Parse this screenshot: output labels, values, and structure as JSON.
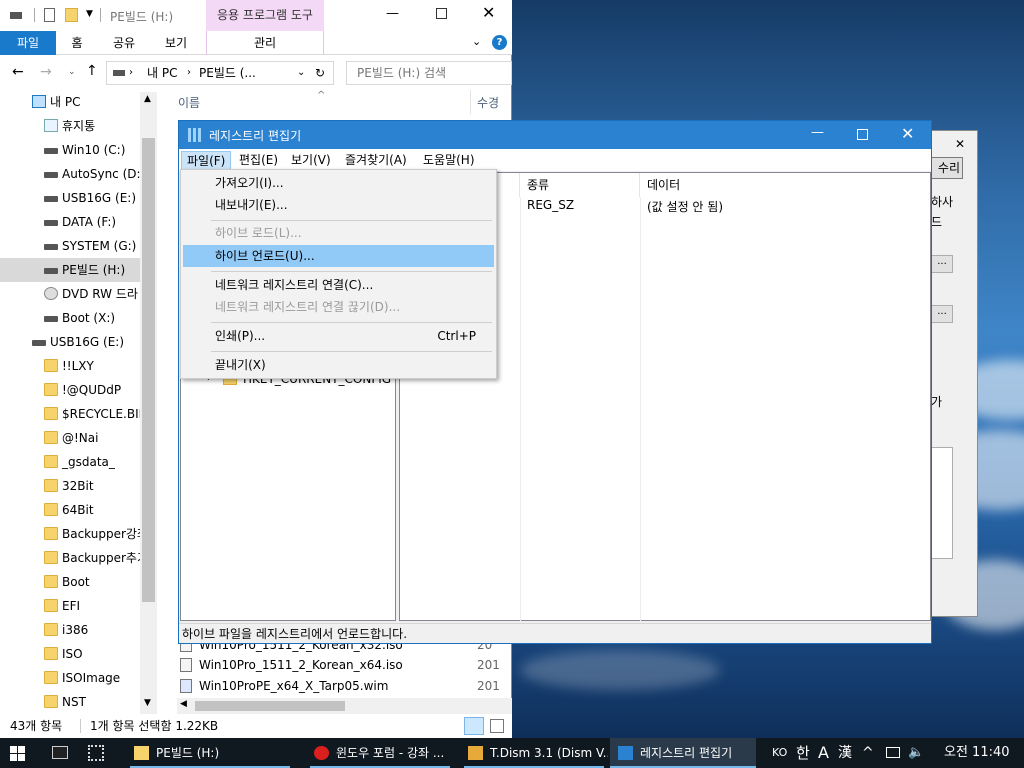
{
  "explorer": {
    "title": "PE빌드 (H:)",
    "contextual_tab": "응용 프로그램 도구",
    "tabs": {
      "file": "파일",
      "home": "홈",
      "share": "공유",
      "view": "보기",
      "manage": "관리"
    },
    "address": {
      "root": "내 PC",
      "current": "PE빌드 (..."
    },
    "search_placeholder": "PE빌드 (H:) 검색",
    "nav": [
      {
        "label": "내 PC",
        "icon": "pc-icon"
      },
      {
        "label": "휴지통",
        "icon": "recycle-bin-icon"
      },
      {
        "label": "Win10 (C:)",
        "icon": "drive-icon"
      },
      {
        "label": "AutoSync (D:)",
        "icon": "drive-icon"
      },
      {
        "label": "USB16G (E:)",
        "icon": "drive-icon"
      },
      {
        "label": "DATA (F:)",
        "icon": "drive-icon"
      },
      {
        "label": "SYSTEM (G:)",
        "icon": "drive-icon"
      },
      {
        "label": "PE빌드 (H:)",
        "icon": "drive-icon"
      },
      {
        "label": "DVD RW 드라",
        "icon": "dvd-icon"
      },
      {
        "label": "Boot (X:)",
        "icon": "drive-icon"
      },
      {
        "label": "USB16G (E:)",
        "icon": "drive-icon"
      },
      {
        "label": "!!LXY",
        "icon": "folder-icon"
      },
      {
        "label": "!@QUDdP",
        "icon": "folder-icon"
      },
      {
        "label": "$RECYCLE.BIN",
        "icon": "folder-icon"
      },
      {
        "label": "@!Nai",
        "icon": "folder-icon"
      },
      {
        "label": "_gsdata_",
        "icon": "folder-icon"
      },
      {
        "label": "32Bit",
        "icon": "folder-icon"
      },
      {
        "label": "64Bit",
        "icon": "folder-icon"
      },
      {
        "label": "Backupper강좌",
        "icon": "folder-icon"
      },
      {
        "label": "Backupper추기",
        "icon": "folder-icon"
      },
      {
        "label": "Boot",
        "icon": "folder-icon"
      },
      {
        "label": "EFI",
        "icon": "folder-icon"
      },
      {
        "label": "i386",
        "icon": "folder-icon"
      },
      {
        "label": "ISO",
        "icon": "folder-icon"
      },
      {
        "label": "ISOImage",
        "icon": "folder-icon"
      },
      {
        "label": "NST",
        "icon": "folder-icon"
      }
    ],
    "columns": {
      "name": "이름",
      "modified": "수경"
    },
    "files": [
      {
        "name": "Win10Pro_1511_2_Korean_x32.iso",
        "date": "20"
      },
      {
        "name": "Win10Pro_1511_2_Korean_x64.iso",
        "date": "201"
      },
      {
        "name": "Win10ProPE_x64_X_Tarp05.wim",
        "date": "201"
      }
    ],
    "status_count": "43개 항목",
    "status_selected": "1개 항목 선택함 1.22KB"
  },
  "regedit": {
    "title": "레지스트리 편집기",
    "menu": {
      "file": "파일(F)",
      "edit": "편집(E)",
      "view": "보기(V)",
      "favorites": "즐겨찾기(A)",
      "help": "도움말(H)"
    },
    "tree_partial": "HKEY_CURRENT_CONFIG",
    "columns": {
      "name": "이름",
      "type": "종류",
      "data": "데이터"
    },
    "rows": [
      {
        "type": "REG_SZ",
        "data": "(값 설정 안 됨)"
      }
    ],
    "status": "하이브 파일을 레지스트리에서 언로드합니다."
  },
  "file_menu": {
    "import": "가져오기(I)...",
    "export": "내보내기(E)...",
    "load_hive": "하이브 로드(L)...",
    "unload_hive": "하이브 언로드(U)...",
    "connect": "네트워크 레지스트리 연결(C)...",
    "disconnect": "네트워크 레지스트리 연결 끊기(D)...",
    "print": "인쇄(P)...",
    "print_shortcut": "Ctrl+P",
    "exit": "끝내기(X)"
  },
  "back_dialog": {
    "btn": "수리",
    "t1": "하사",
    "t2": "드",
    "t3": "가",
    "ellipsis": "..."
  },
  "taskbar": {
    "apps": [
      {
        "label": "PE빌드 (H:)"
      },
      {
        "label": "윈도우 포럼 - 강좌 ..."
      },
      {
        "label": "T.Dism 3.1 (Dism V..."
      },
      {
        "label": "레지스트리 편집기"
      }
    ],
    "ime_lang": "KO",
    "ime_mode": "한",
    "ime_a": "A",
    "ime_hanja": "漢",
    "clock": "오전 11:40"
  }
}
